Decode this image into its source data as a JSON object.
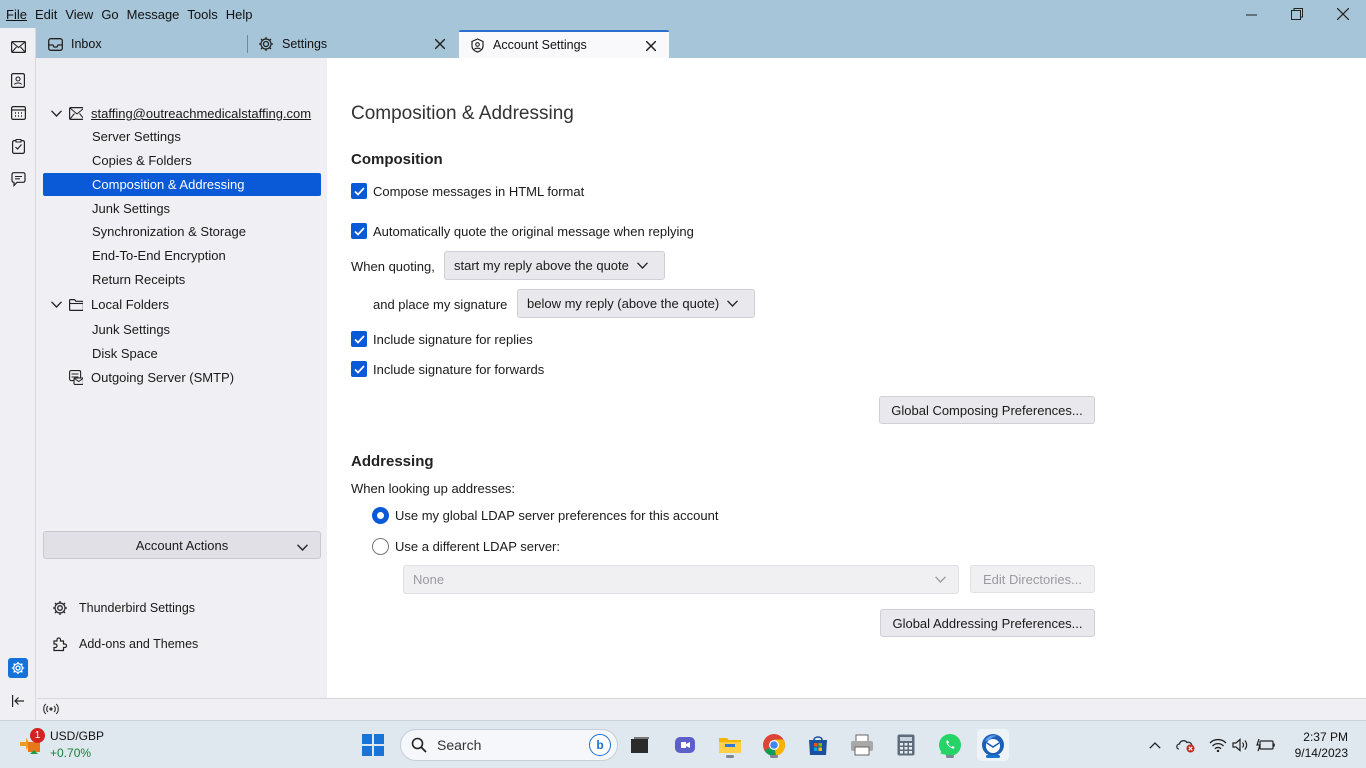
{
  "menu": [
    "File",
    "Edit",
    "View",
    "Go",
    "Message",
    "Tools",
    "Help"
  ],
  "tabs": [
    {
      "label": "Inbox"
    },
    {
      "label": "Settings"
    },
    {
      "label": "Account Settings"
    }
  ],
  "sidebar": {
    "account": "staffing@outreachmedicalstaffing.com",
    "account_items": [
      "Server Settings",
      "Copies & Folders",
      "Composition & Addressing",
      "Junk Settings",
      "Synchronization & Storage",
      "End-To-End Encryption",
      "Return Receipts"
    ],
    "local_folders": "Local Folders",
    "local_items": [
      "Junk Settings",
      "Disk Space"
    ],
    "outgoing": "Outgoing Server (SMTP)",
    "account_actions": "Account Actions",
    "thunderbird_settings": "Thunderbird Settings",
    "addons": "Add-ons and Themes"
  },
  "main": {
    "title": "Composition & Addressing",
    "composition_heading": "Composition",
    "compose_html": "Compose messages in HTML format",
    "auto_quote": "Automatically quote the original message when replying",
    "when_quoting": "When quoting,",
    "quote_select": "start my reply above the quote",
    "place_signature": "and place my signature",
    "signature_select": "below my reply (above the quote)",
    "sig_replies": "Include signature for replies",
    "sig_forwards": "Include signature for forwards",
    "global_composing_btn": "Global Composing Preferences...",
    "addressing_heading": "Addressing",
    "lookup_label": "When looking up addresses:",
    "radio_global": "Use my global LDAP server preferences for this account",
    "radio_different": "Use a different LDAP server:",
    "ldap_select": "None",
    "edit_directories": "Edit Directories...",
    "global_addressing_btn": "Global Addressing Preferences..."
  },
  "taskbar": {
    "widget_title": "USD/GBP",
    "widget_value": "+0.70%",
    "widget_badge": "1",
    "search_placeholder": "Search",
    "time": "2:37 PM",
    "date": "9/14/2023"
  },
  "colors": {
    "accent": "#0a5ad8",
    "titlebar": "#a7c5d9"
  }
}
